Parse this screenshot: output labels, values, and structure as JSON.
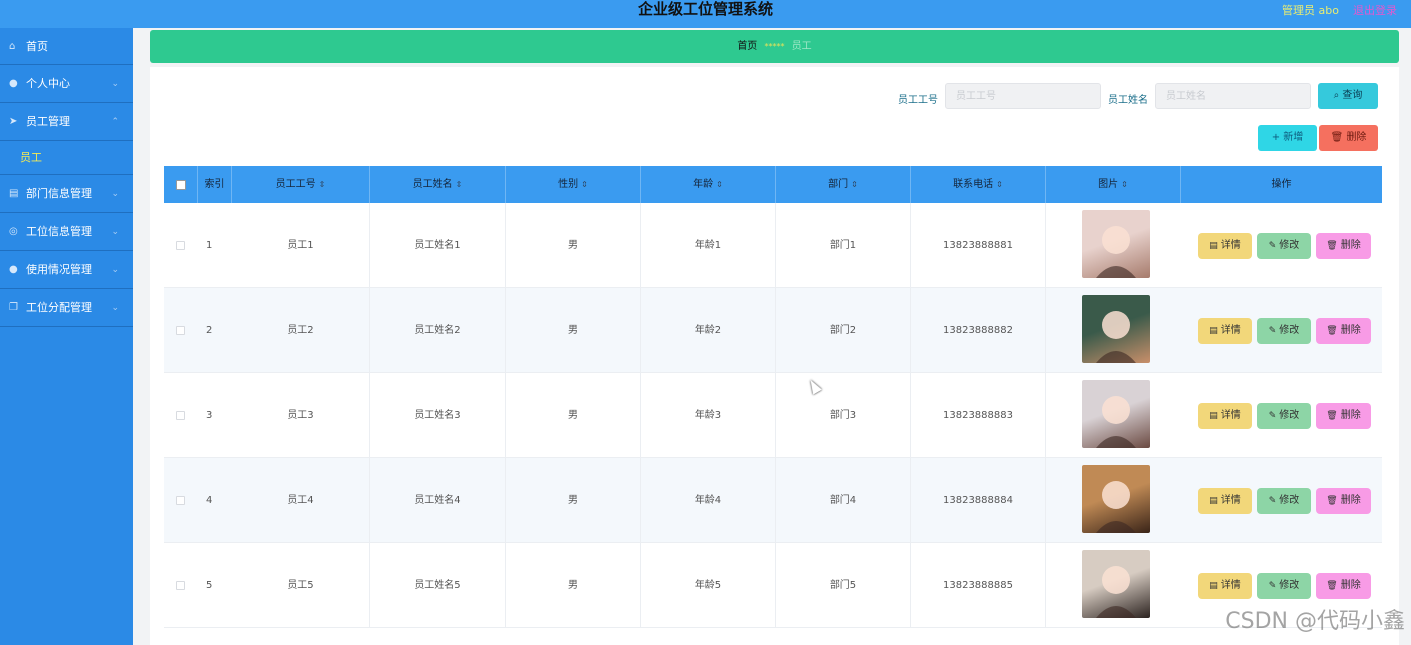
{
  "header": {
    "title": "企业级工位管理系统",
    "user": "管理员 abo",
    "logout": "退出登录"
  },
  "sidebar": {
    "items": [
      {
        "label": "首页",
        "icon": "home-icon",
        "glyph": "⌂",
        "chevron": ""
      },
      {
        "label": "个人中心",
        "icon": "user-icon",
        "glyph": "●",
        "chevron": "⌄"
      },
      {
        "label": "员工管理",
        "icon": "send-icon",
        "glyph": "➤",
        "chevron": "⌃"
      },
      {
        "label": "部门信息管理",
        "icon": "clipboard-icon",
        "glyph": "▤",
        "chevron": "⌄"
      },
      {
        "label": "工位信息管理",
        "icon": "globe-icon",
        "glyph": "◎",
        "chevron": "⌄"
      },
      {
        "label": "使用情况管理",
        "icon": "mic-icon",
        "glyph": "●",
        "chevron": "⌄"
      },
      {
        "label": "工位分配管理",
        "icon": "copy-icon",
        "glyph": "❐",
        "chevron": "⌄"
      }
    ],
    "subitem": "员工"
  },
  "breadcrumb": {
    "home": "首页",
    "separator": "*****",
    "current": "员工"
  },
  "search": {
    "id_label": "员工工号",
    "id_placeholder": "员工工号",
    "name_label": "员工姓名",
    "name_placeholder": "员工姓名",
    "query_label": "查询"
  },
  "toolbar": {
    "add_label": "新增",
    "delete_label": "删除"
  },
  "table": {
    "columns": [
      "索引",
      "员工工号",
      "员工姓名",
      "性别",
      "年龄",
      "部门",
      "联系电话",
      "图片",
      "操作"
    ],
    "action_labels": {
      "detail": "详情",
      "edit": "修改",
      "remove": "删除"
    },
    "rows": [
      {
        "index": "1",
        "emp_no": "员工1",
        "name": "员工姓名1",
        "gender": "男",
        "age": "年龄1",
        "dept": "部门1",
        "phone": "13823888881"
      },
      {
        "index": "2",
        "emp_no": "员工2",
        "name": "员工姓名2",
        "gender": "男",
        "age": "年龄2",
        "dept": "部门2",
        "phone": "13823888882"
      },
      {
        "index": "3",
        "emp_no": "员工3",
        "name": "员工姓名3",
        "gender": "男",
        "age": "年龄3",
        "dept": "部门3",
        "phone": "13823888883"
      },
      {
        "index": "4",
        "emp_no": "员工4",
        "name": "员工姓名4",
        "gender": "男",
        "age": "年龄4",
        "dept": "部门4",
        "phone": "13823888884"
      },
      {
        "index": "5",
        "emp_no": "员工5",
        "name": "员工姓名5",
        "gender": "男",
        "age": "年龄5",
        "dept": "部门5",
        "phone": "13823888885"
      }
    ]
  },
  "watermark": "CSDN @代码小鑫",
  "colors": {
    "topbar": "#3a9bf0",
    "sidebar": "#2b8ae6",
    "breadcrumb": "#2ec990",
    "detail_button": "#f2d77a",
    "edit_button": "#8dd5a6",
    "remove_button": "#f89be6"
  }
}
